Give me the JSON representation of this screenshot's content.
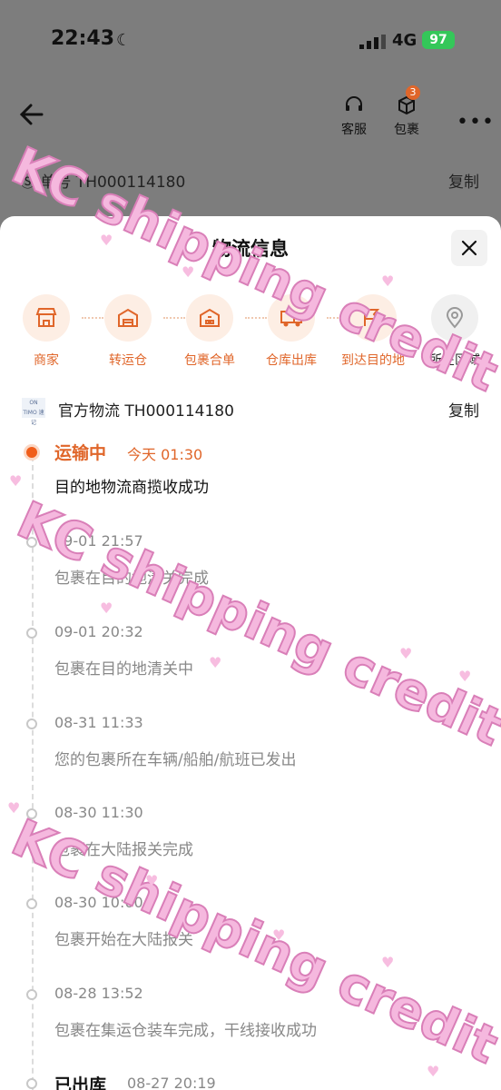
{
  "status_bar": {
    "time": "22:43",
    "network": "4G",
    "battery": "97"
  },
  "header": {
    "customer_service_label": "客服",
    "package_label": "包裹",
    "package_badge": "3"
  },
  "background": {
    "tracking_text": "Ⓢ 单号 TH000114180",
    "copy_label": "复制"
  },
  "sheet": {
    "title": "物流信息",
    "steps": [
      {
        "label": "商家",
        "icon": "store-icon"
      },
      {
        "label": "转运仓",
        "icon": "warehouse-icon"
      },
      {
        "label": "包裹合单",
        "icon": "package-merge-icon"
      },
      {
        "label": "仓库出库",
        "icon": "truck-icon"
      },
      {
        "label": "到达目的地",
        "icon": "destination-icon"
      },
      {
        "label": "所在区域",
        "icon": "location-icon"
      }
    ],
    "carrier": {
      "logo_text": "ON TIMO 速记",
      "text": "官方物流 TH000114180",
      "copy_label": "复制"
    },
    "timeline": [
      {
        "status": "运输中",
        "time": "今天 01:30",
        "desc": "目的地物流商揽收成功",
        "active": true
      },
      {
        "status": "",
        "time": "09-01 21:57",
        "desc": "包裹在目的地清关完成"
      },
      {
        "status": "",
        "time": "09-01 20:32",
        "desc": "包裹在目的地清关中"
      },
      {
        "status": "",
        "time": "08-31 11:33",
        "desc": "您的包裹所在车辆/船舶/航班已发出"
      },
      {
        "status": "",
        "time": "08-30 11:30",
        "desc": "包裹在大陆报关完成"
      },
      {
        "status": "",
        "time": "08-30 10:00",
        "desc": "包裹开始在大陆报关"
      },
      {
        "status": "",
        "time": "08-28 13:52",
        "desc": "包裹在集运仓装车完成，干线接收成功"
      },
      {
        "status": "已出库",
        "time": "08-27 20:19",
        "desc": ""
      }
    ]
  },
  "watermark": {
    "text": "KC shipping credit"
  }
}
